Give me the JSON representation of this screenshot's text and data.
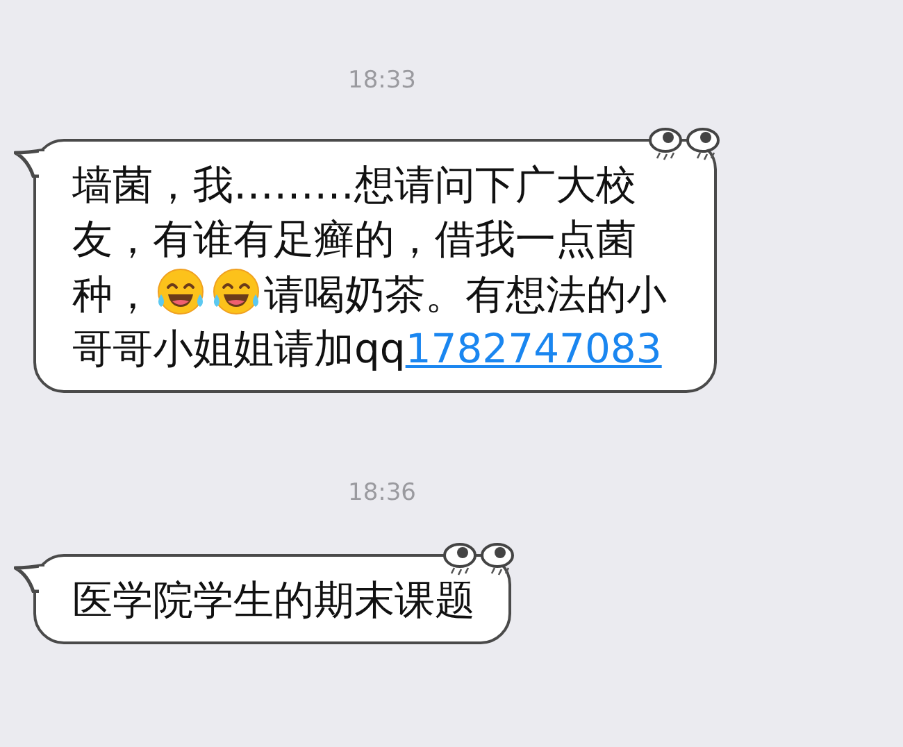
{
  "chat": [
    {
      "kind": "time",
      "text": "18:33"
    },
    {
      "kind": "message",
      "segments": [
        {
          "kind": "text",
          "text": "墙菌，我………想请问下广大校友，有谁有足癣的，借我一点菌种，"
        },
        {
          "kind": "emoji"
        },
        {
          "kind": "emoji"
        },
        {
          "kind": "text",
          "text": "请喝奶茶。有想法的小哥哥小姐姐请加qq"
        },
        {
          "kind": "link",
          "text": "1782747083"
        }
      ]
    },
    {
      "kind": "time",
      "text": "18:36"
    },
    {
      "kind": "message",
      "segments": [
        {
          "kind": "text",
          "text": "医学院学生的期末课题"
        }
      ]
    }
  ]
}
